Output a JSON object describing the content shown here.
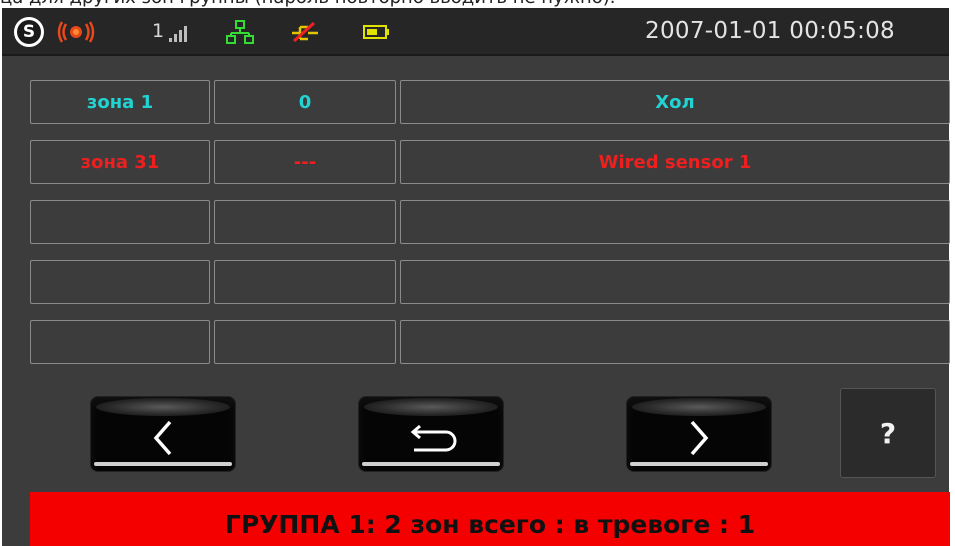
{
  "caption": "ца для других зон группы (пароль повторно вводить не нужно).",
  "status_bar": {
    "logo_letter": "S",
    "signal_number": "1",
    "datetime": "2007-01-01 00:05:08",
    "icons": [
      "logo-icon",
      "siren-alarm-icon",
      "signal-bars-icon",
      "network-icon",
      "power-disconnected-icon",
      "battery-icon"
    ]
  },
  "colors": {
    "background": "#3c3c3c",
    "status_bar": "#262626",
    "normal_text": "#22d3d3",
    "alarm_text": "#ef1f1f",
    "footer": "#f50000"
  },
  "zones": [
    {
      "zone": "зона 1",
      "value": "0",
      "name": "Хол",
      "state": "normal"
    },
    {
      "zone": "зона 31",
      "value": "---",
      "name": "Wired sensor 1",
      "state": "alarm"
    },
    {
      "zone": "",
      "value": "",
      "name": "",
      "state": "empty"
    },
    {
      "zone": "",
      "value": "",
      "name": "",
      "state": "empty"
    },
    {
      "zone": "",
      "value": "",
      "name": "",
      "state": "empty"
    }
  ],
  "buttons": {
    "prev_icon": "chevron-left-icon",
    "back_icon": "return-arrow-icon",
    "next_icon": "chevron-right-icon",
    "help_label": "?"
  },
  "footer": {
    "text": "ГРУППА 1: 2 зон всего :  в тревоге : 1"
  }
}
